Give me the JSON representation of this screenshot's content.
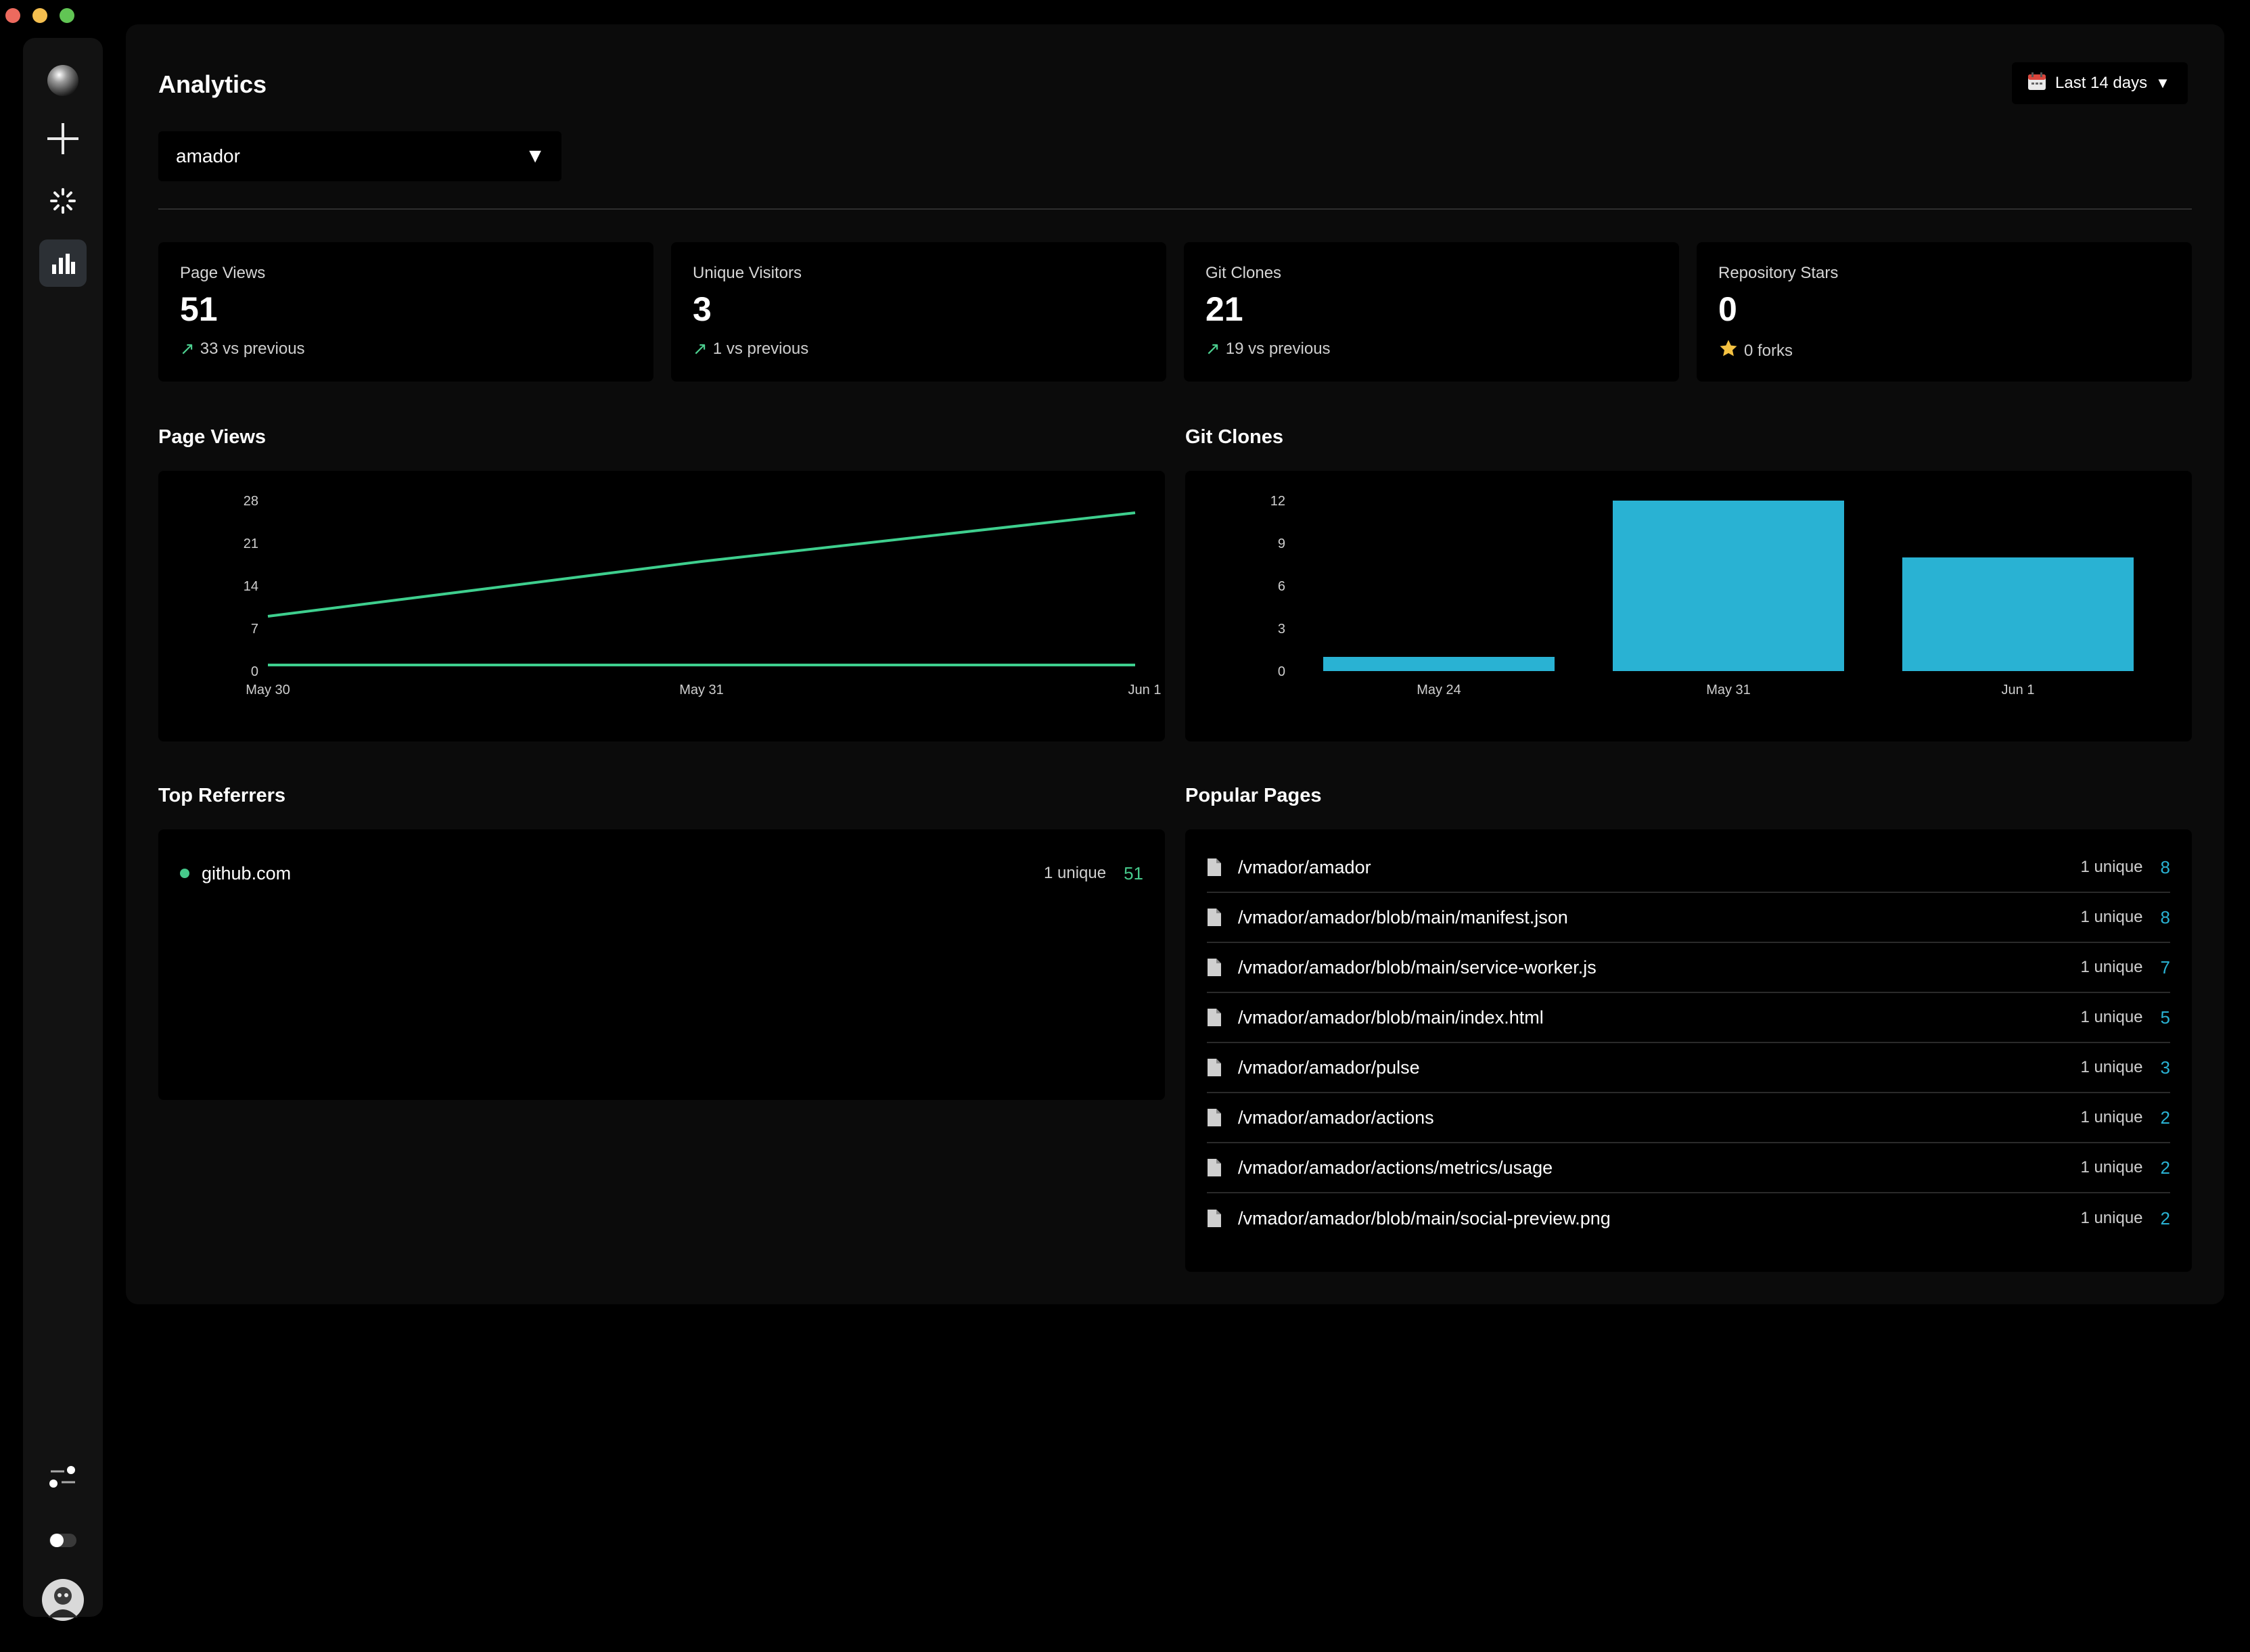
{
  "window": {
    "buttons": [
      "close",
      "minimize",
      "zoom"
    ]
  },
  "sidebar": {
    "items": [
      {
        "icon": "sphere-logo-icon"
      },
      {
        "icon": "plus-icon"
      },
      {
        "icon": "spinner-icon"
      },
      {
        "icon": "bar-chart-icon",
        "active": true
      },
      {
        "icon": "settings-toggle-icon"
      },
      {
        "icon": "toggle-icon"
      },
      {
        "icon": "avatar"
      }
    ]
  },
  "header": {
    "title": "Analytics",
    "date_range": "Last 14 days",
    "repo_select": {
      "value": "amador"
    }
  },
  "stats": [
    {
      "label": "Page Views",
      "value": "51",
      "sub": "33 vs previous",
      "icon": "trend-up-icon"
    },
    {
      "label": "Unique Visitors",
      "value": "3",
      "sub": "1 vs previous",
      "icon": "trend-up-icon"
    },
    {
      "label": "Git Clones",
      "value": "21",
      "sub": "19 vs previous",
      "icon": "trend-up-icon"
    },
    {
      "label": "Repository Stars",
      "value": "0",
      "sub": "0 forks",
      "icon": "star-icon"
    }
  ],
  "charts": {
    "page_views_title": "Page Views",
    "git_clones_title": "Git Clones"
  },
  "chart_data": [
    {
      "type": "line",
      "title": "Page Views",
      "x": [
        "May 30",
        "May 31",
        "Jun 1"
      ],
      "series": [
        {
          "values": [
            9,
            18,
            26
          ],
          "color": "#3ecf8e"
        },
        {
          "values": [
            1,
            1,
            1
          ],
          "color": "#3ecf8e"
        }
      ],
      "y_ticks": [
        0,
        7,
        14,
        21,
        28
      ],
      "ylim": [
        0,
        28
      ],
      "grid": false
    },
    {
      "type": "bar",
      "title": "Git Clones",
      "categories": [
        "May 24",
        "May 31",
        "Jun 1"
      ],
      "values": [
        1,
        12,
        8
      ],
      "color": "#29b2d3",
      "y_ticks": [
        0,
        3,
        6,
        9,
        12
      ],
      "ylim": [
        0,
        12
      ],
      "grid": false
    }
  ],
  "referrers": {
    "title": "Top Referrers",
    "items": [
      {
        "name": "github.com",
        "unique": "1 unique",
        "count": "51"
      }
    ]
  },
  "popular_pages": {
    "title": "Popular Pages",
    "items": [
      {
        "path": "/vmador/amador",
        "unique": "1 unique",
        "count": "8"
      },
      {
        "path": "/vmador/amador/blob/main/manifest.json",
        "unique": "1 unique",
        "count": "8"
      },
      {
        "path": "/vmador/amador/blob/main/service-worker.js",
        "unique": "1 unique",
        "count": "7"
      },
      {
        "path": "/vmador/amador/blob/main/index.html",
        "unique": "1 unique",
        "count": "5"
      },
      {
        "path": "/vmador/amador/pulse",
        "unique": "1 unique",
        "count": "3"
      },
      {
        "path": "/vmador/amador/actions",
        "unique": "1 unique",
        "count": "2"
      },
      {
        "path": "/vmador/amador/actions/metrics/usage",
        "unique": "1 unique",
        "count": "2"
      },
      {
        "path": "/vmador/amador/blob/main/social-preview.png",
        "unique": "1 unique",
        "count": "2"
      }
    ]
  },
  "colors": {
    "accent_green": "#3ecf8e",
    "accent_blue": "#29b2d3",
    "panel": "#000000",
    "background": "#0b0b0b"
  }
}
